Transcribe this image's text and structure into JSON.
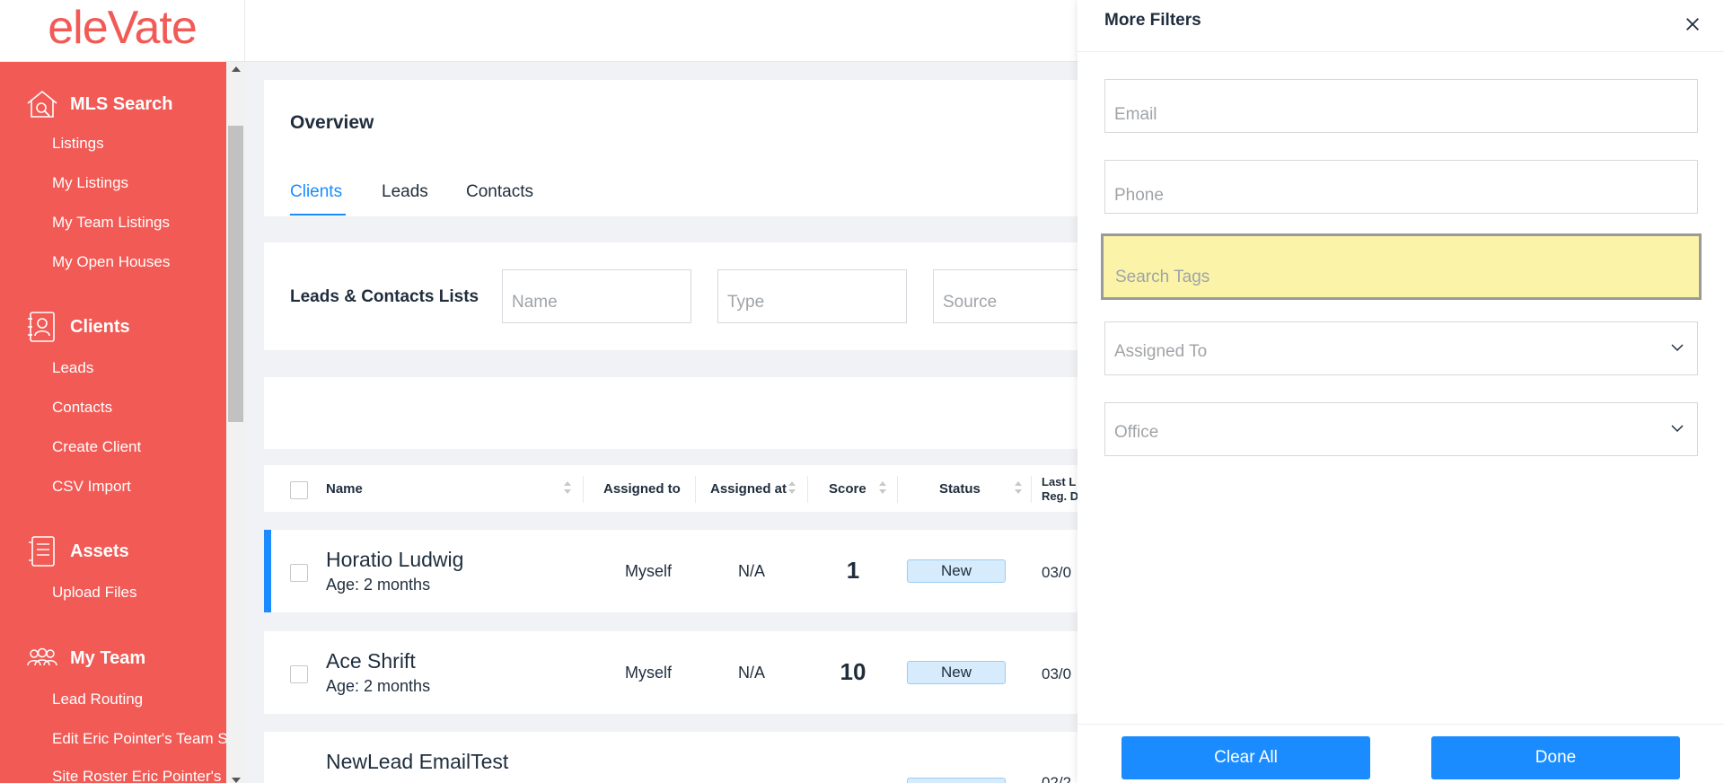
{
  "brand": {
    "logo_text": "eleVate",
    "logo_color": "#f25a55"
  },
  "sidebar": {
    "sections": [
      {
        "title": "MLS Search",
        "icon": "house-search-icon",
        "items": [
          "Listings",
          "My Listings",
          "My Team Listings",
          "My Open Houses"
        ]
      },
      {
        "title": "Clients",
        "icon": "contact-card-icon",
        "items": [
          "Leads",
          "Contacts",
          "Create Client",
          "CSV Import"
        ]
      },
      {
        "title": "Assets",
        "icon": "document-icon",
        "items": [
          "Upload Files"
        ]
      },
      {
        "title": "My Team",
        "icon": "team-icon",
        "items": [
          "Lead Routing",
          "Edit Eric Pointer's Team S",
          "Site Roster Eric Pointer's"
        ]
      }
    ]
  },
  "overview": {
    "title": "Overview",
    "tabs": [
      "Clients",
      "Leads",
      "Contacts"
    ],
    "active_tab": "Clients"
  },
  "lists_filter": {
    "label": "Leads & Contacts Lists",
    "name_placeholder": "Name",
    "type_placeholder": "Type",
    "source_placeholder": "Source"
  },
  "table": {
    "headers": {
      "name": "Name",
      "assigned_to": "Assigned to",
      "assigned_at": "Assigned at",
      "score": "Score",
      "status": "Status",
      "last_line1": "Last L",
      "last_line2": "Reg. D"
    },
    "rows": [
      {
        "name": "Horatio Ludwig",
        "age": "Age: 2 months",
        "assigned_to": "Myself",
        "assigned_at": "N/A",
        "score": "1",
        "status": "New",
        "date": "03/0"
      },
      {
        "name": "Ace Shrift",
        "age": "Age: 2 months",
        "assigned_to": "Myself",
        "assigned_at": "N/A",
        "score": "10",
        "status": "New",
        "date": "03/0"
      },
      {
        "name": "NewLead EmailTest",
        "age": "",
        "assigned_to": "",
        "assigned_at": "",
        "score": "",
        "status": "",
        "date": "02/2"
      }
    ]
  },
  "filters_panel": {
    "title": "More Filters",
    "close_icon": "close-icon",
    "email_placeholder": "Email",
    "phone_placeholder": "Phone",
    "tags_placeholder": "Search Tags",
    "assigned_to_label": "Assigned To",
    "office_label": "Office",
    "clear_label": "Clear All",
    "done_label": "Done",
    "accent_color": "#1a8cff",
    "highlight_color": "#fbf4a8"
  }
}
